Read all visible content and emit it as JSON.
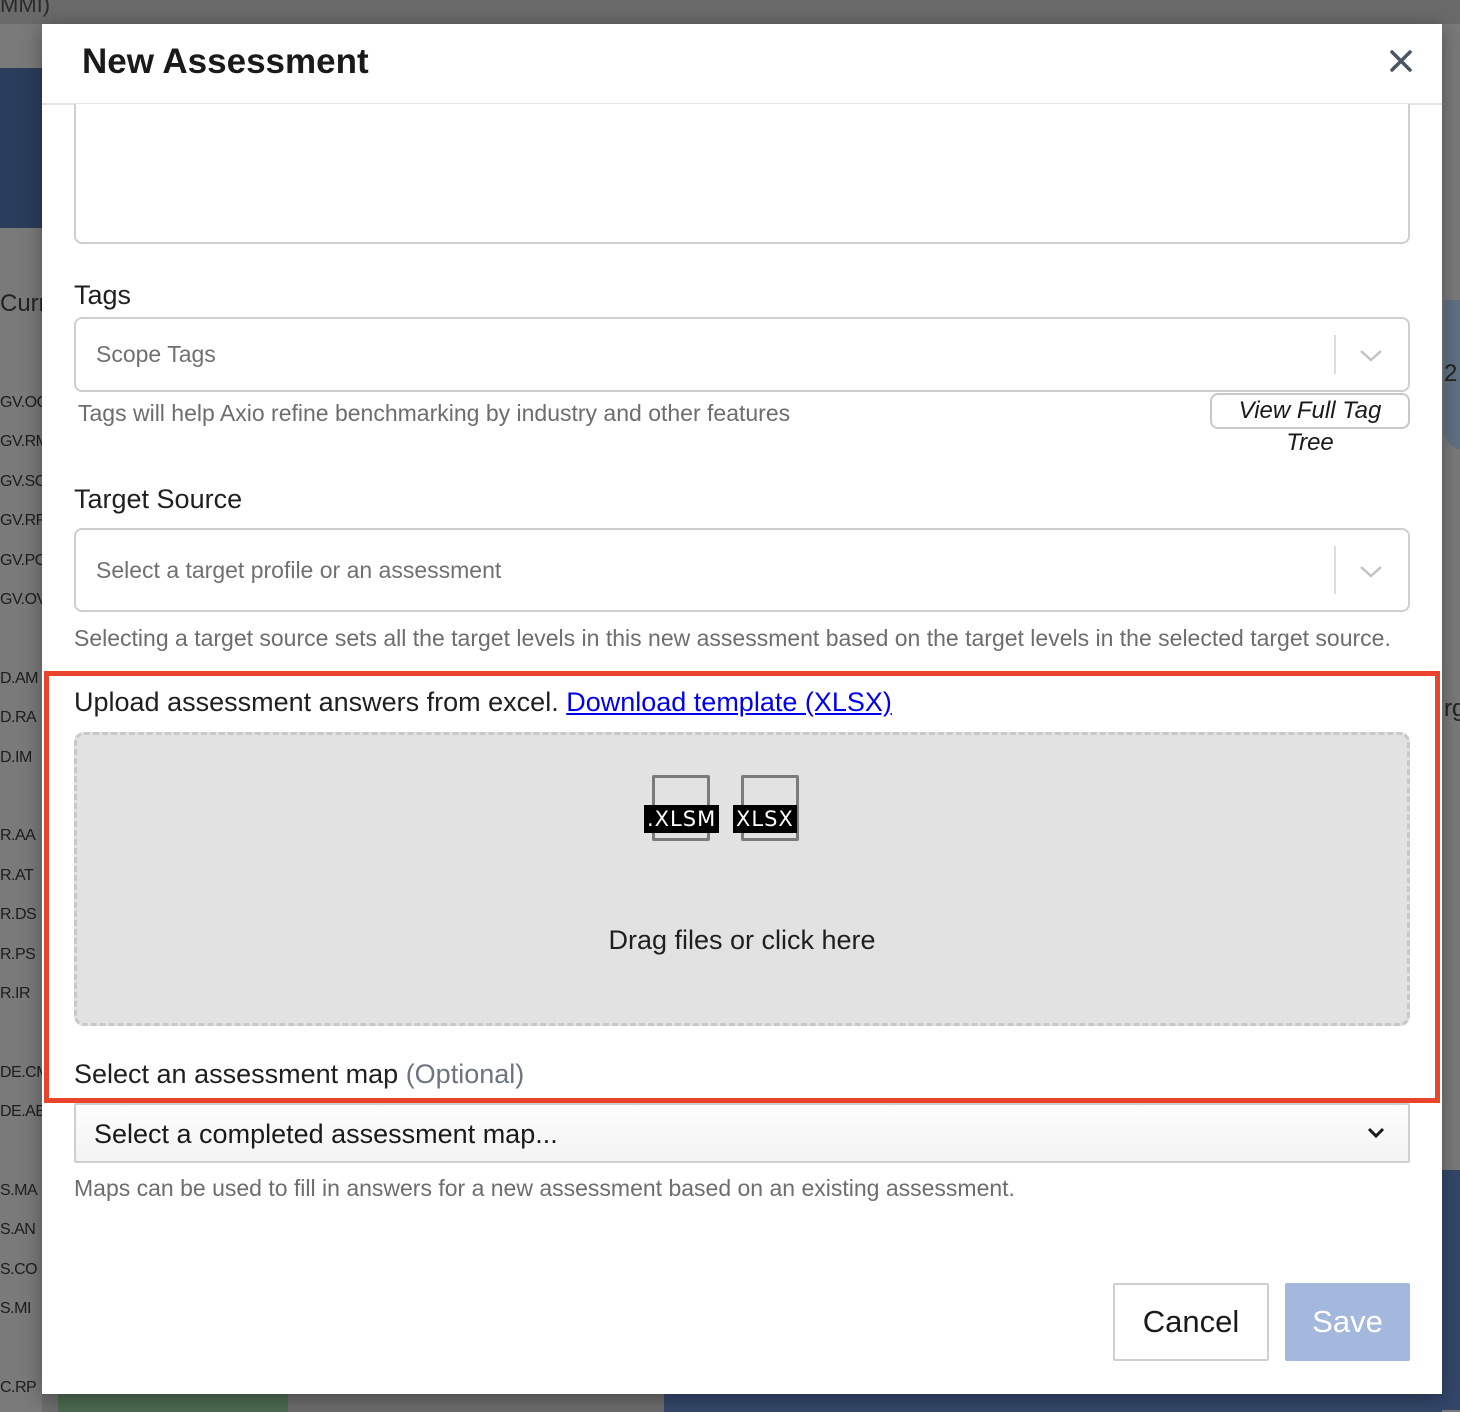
{
  "background": {
    "top_text": "MMI)",
    "side_heading": "Curr",
    "left_codes": [
      "GV.OC",
      "GV.RM",
      "GV.SC",
      "GV.RR",
      "GV.PO",
      "GV.OV",
      "D.AM",
      "D.RA",
      "D.IM",
      "R.AA",
      "R.AT",
      "R.DS",
      "R.PS",
      "R.IR",
      "DE.CM",
      "DE.AE",
      "S.MA",
      "S.AN",
      "S.CO",
      "S.MI",
      "C.RP"
    ],
    "right_number": "2",
    "right_letter": "rg"
  },
  "modal": {
    "title": "New Assessment",
    "tags": {
      "label": "Tags",
      "placeholder": "Scope Tags",
      "help": "Tags will help Axio refine benchmarking by industry and other features",
      "view_tree_button": "View Full Tag Tree"
    },
    "target_source": {
      "label": "Target Source",
      "placeholder": "Select a target profile or an assessment",
      "help": "Selecting a target source sets all the target levels in this new assessment based on the target levels in the selected target source."
    },
    "upload": {
      "label": "Upload assessment answers from excel.",
      "template_link": "Download template (XLSX)",
      "file_types": [
        ".XLSM",
        "XLSX"
      ],
      "drop_text": "Drag files or click here"
    },
    "assessment_map": {
      "label": "Select an assessment map",
      "optional": "(Optional)",
      "selected": "Select a completed assessment map...",
      "help": "Maps can be used to fill in answers for a new assessment based on an existing assessment."
    },
    "buttons": {
      "cancel": "Cancel",
      "save": "Save"
    }
  },
  "colors": {
    "highlight": "#e8452c",
    "save_disabled": "#a3b8dc",
    "link": "#0000ee"
  }
}
